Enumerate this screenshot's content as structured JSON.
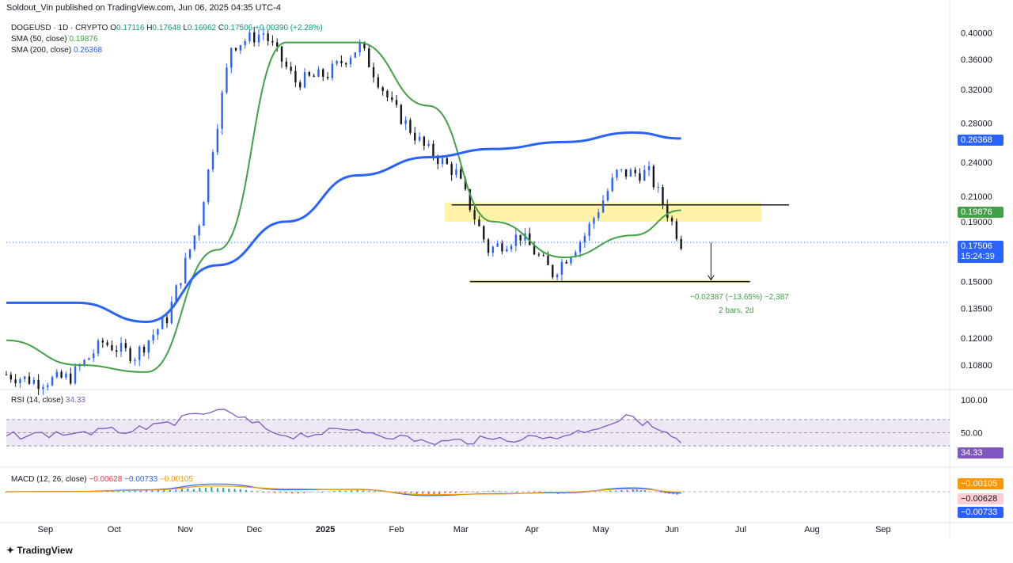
{
  "header": {
    "publisher": "Soldout_Vin published on TradingView.com, Jun 06, 2025 04:35 UTC-4"
  },
  "legend": {
    "symbol": "DOGEUSD · 1D · CRYPTO",
    "open_label": "O",
    "open": "0.17116",
    "high_label": "H",
    "high": "0.17648",
    "low_label": "L",
    "low": "0.16962",
    "close_label": "C",
    "close": "0.17506",
    "change": "+0.00390 (+2.28%)",
    "sma50_label": "SMA (50, close)",
    "sma50_value": "0.19876",
    "sma200_label": "SMA (200, close)",
    "sma200_value": "0.26368",
    "rsi_label": "RSI (14, close)",
    "rsi_value": "34.33",
    "macd_label": "MACD (12, 26, close)",
    "macd_hist": "−0.00628",
    "macd_line": "−0.00733",
    "macd_signal": "−0.00105"
  },
  "price_tags": {
    "sma200": "0.26368",
    "sma50": "0.19876",
    "last": "0.17506",
    "countdown": "15:24:39",
    "rsi": "34.33",
    "macd_signal": "−0.00105",
    "macd_hist": "−0.00628",
    "macd_line": "−0.00733"
  },
  "measure": {
    "line1": "−0.02387 (−13.65%) −2,387",
    "line2": "2 bars, 2d"
  },
  "footer": {
    "brand": "TradingView"
  },
  "colors": {
    "sma50": "#43a047",
    "sma200": "#2962ff",
    "up": "#2962ff",
    "down": "#131722",
    "rsi": "#7e57c2",
    "zone": "#fff3a8"
  },
  "chart_data": [
    {
      "type": "candlestick",
      "title": "DOGEUSD · 1D · CRYPTO",
      "yscale": "log",
      "yticks": [
        "0.40000",
        "0.36000",
        "0.32000",
        "0.28000",
        "0.24000",
        "0.21000",
        "0.19000",
        "0.15000",
        "0.13500",
        "0.12000",
        "0.10800"
      ],
      "xticks": [
        "Sep",
        "Oct",
        "Nov",
        "Dec",
        "2025",
        "Feb",
        "Mar",
        "Apr",
        "May",
        "Jun",
        "Jul",
        "Aug",
        "Sep"
      ],
      "ylim": [
        0.098,
        0.425
      ],
      "series": [
        {
          "name": "DOGEUSD",
          "x": [
            "2024-08-15",
            "2024-08-29",
            "2024-09-12",
            "2024-09-26",
            "2024-10-10",
            "2024-10-24",
            "2024-11-07",
            "2024-11-21",
            "2024-12-05",
            "2024-12-19",
            "2025-01-02",
            "2025-01-16",
            "2025-01-30",
            "2025-02-13",
            "2025-02-27",
            "2025-03-13",
            "2025-03-27",
            "2025-04-10",
            "2025-04-24",
            "2025-05-08",
            "2025-05-22",
            "2025-06-05"
          ],
          "values": [
            0.104,
            0.101,
            0.103,
            0.118,
            0.112,
            0.13,
            0.19,
            0.38,
            0.4,
            0.33,
            0.34,
            0.38,
            0.3,
            0.255,
            0.23,
            0.17,
            0.18,
            0.155,
            0.18,
            0.23,
            0.23,
            0.175
          ]
        },
        {
          "name": "SMA (50, close)",
          "x": [
            "2024-08-15",
            "2024-09-15",
            "2024-10-15",
            "2024-11-15",
            "2024-12-15",
            "2025-01-15",
            "2025-02-15",
            "2025-03-15",
            "2025-04-15",
            "2025-05-15",
            "2025-06-05"
          ],
          "values": [
            0.119,
            0.108,
            0.105,
            0.17,
            0.385,
            0.385,
            0.3,
            0.19,
            0.165,
            0.18,
            0.19876
          ]
        },
        {
          "name": "SMA (200, close)",
          "x": [
            "2024-08-15",
            "2024-09-15",
            "2024-10-15",
            "2024-11-15",
            "2024-12-15",
            "2025-01-15",
            "2025-02-15",
            "2025-03-15",
            "2025-04-15",
            "2025-05-15",
            "2025-06-05"
          ],
          "values": [
            0.138,
            0.138,
            0.128,
            0.16,
            0.19,
            0.228,
            0.245,
            0.253,
            0.26,
            0.27,
            0.26368
          ]
        }
      ],
      "annotations": [
        "resistance zone 0.190–0.205",
        "support line 0.150",
        "measure −0.02387 (−13.65%)"
      ]
    },
    {
      "type": "line",
      "title": "RSI (14, close)",
      "yticks": [
        "100.00",
        "50.00"
      ],
      "ylim": [
        0,
        100
      ],
      "series": [
        {
          "name": "RSI (14, close)",
          "x": [
            "2024-08-15",
            "2024-09-15",
            "2024-10-15",
            "2024-11-15",
            "2024-12-15",
            "2025-01-15",
            "2025-02-15",
            "2025-03-15",
            "2025-04-15",
            "2025-05-15",
            "2025-06-05"
          ],
          "values": [
            45,
            50,
            55,
            85,
            45,
            55,
            35,
            40,
            45,
            75,
            34.33
          ]
        }
      ]
    },
    {
      "type": "bar",
      "title": "MACD (12, 26, close)",
      "series": [
        {
          "name": "Histogram",
          "values": [
            0.0,
            0.001,
            0.003,
            0.008,
            -0.004,
            0.004,
            -0.006,
            0.002,
            -0.004,
            0.005,
            -0.00628
          ]
        },
        {
          "name": "MACD",
          "values": [
            0.0,
            0.002,
            0.01,
            0.04,
            0.01,
            0.012,
            -0.02,
            -0.01,
            -0.005,
            0.02,
            -0.00733
          ]
        },
        {
          "name": "Signal",
          "values": [
            0.0,
            0.001,
            0.008,
            0.03,
            0.015,
            0.01,
            -0.015,
            -0.012,
            -0.002,
            0.015,
            -0.00105
          ]
        }
      ]
    }
  ]
}
